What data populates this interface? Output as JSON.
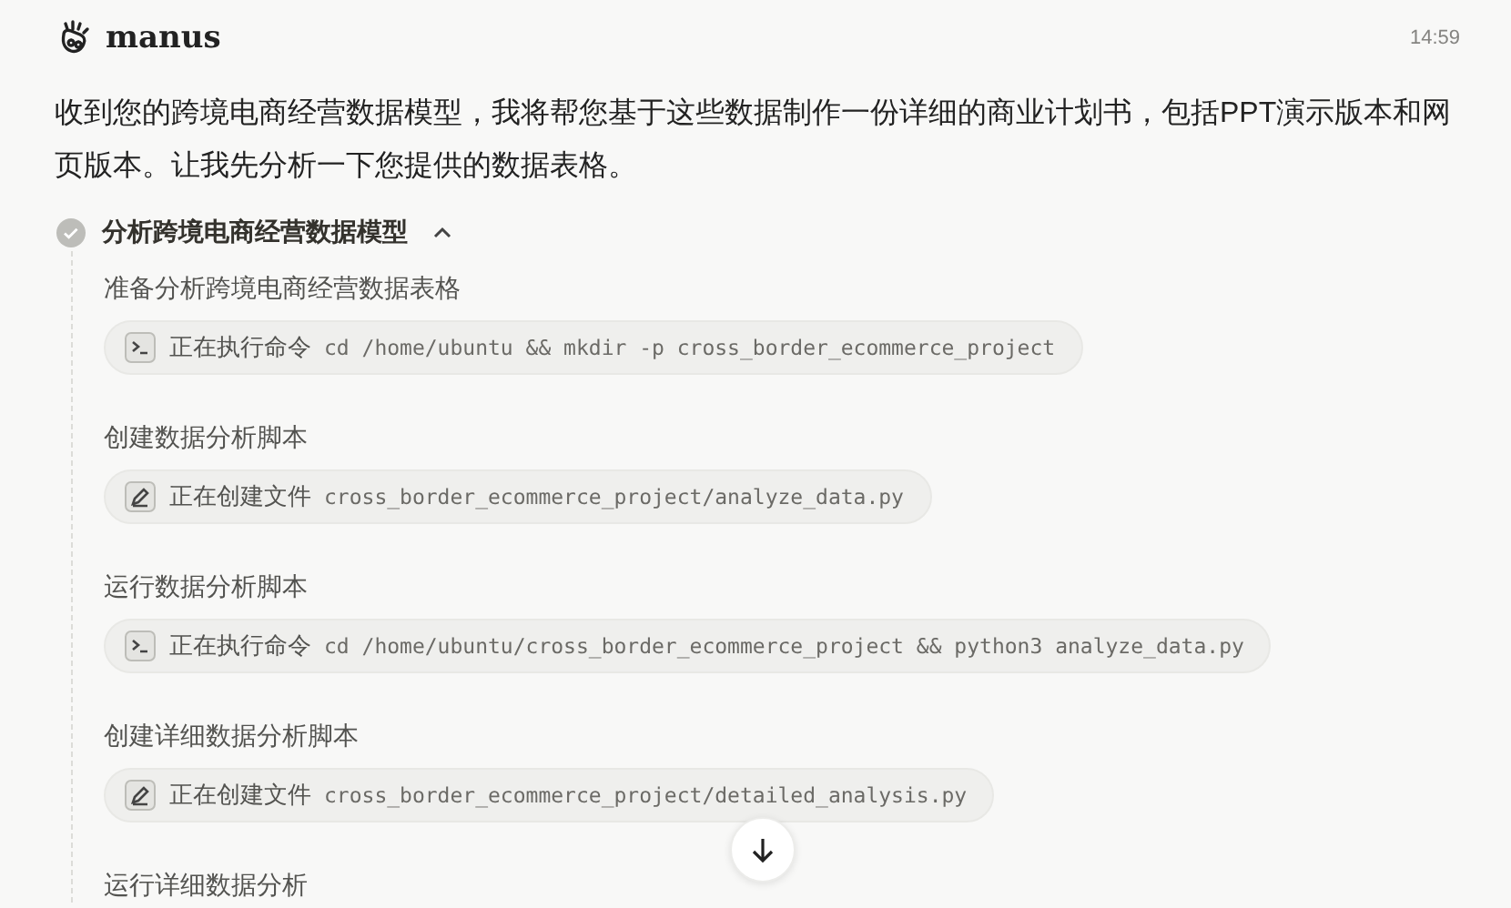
{
  "header": {
    "brand": "manus",
    "time": "14:59"
  },
  "message": "收到您的跨境电商经营数据模型，我将帮您基于这些数据制作一份详细的商业计划书，包括PPT演示版本和网页版本。让我先分析一下您提供的数据表格。",
  "task": {
    "title": "分析跨境电商经营数据模型",
    "done": true,
    "expanded": true,
    "steps": [
      {
        "label": "准备分析跨境电商经营数据表格",
        "action": {
          "kind": "command",
          "verb": "正在执行命令",
          "detail": "cd /home/ubuntu && mkdir -p cross_border_ecommerce_project"
        }
      },
      {
        "label": "创建数据分析脚本",
        "action": {
          "kind": "file",
          "verb": "正在创建文件",
          "detail": "cross_border_ecommerce_project/analyze_data.py"
        }
      },
      {
        "label": "运行数据分析脚本",
        "action": {
          "kind": "command",
          "verb": "正在执行命令",
          "detail": "cd /home/ubuntu/cross_border_ecommerce_project && python3 analyze_data.py"
        }
      },
      {
        "label": "创建详细数据分析脚本",
        "action": {
          "kind": "file",
          "verb": "正在创建文件",
          "detail": "cross_border_ecommerce_project/detailed_analysis.py"
        }
      },
      {
        "label": "运行详细数据分析"
      }
    ]
  }
}
